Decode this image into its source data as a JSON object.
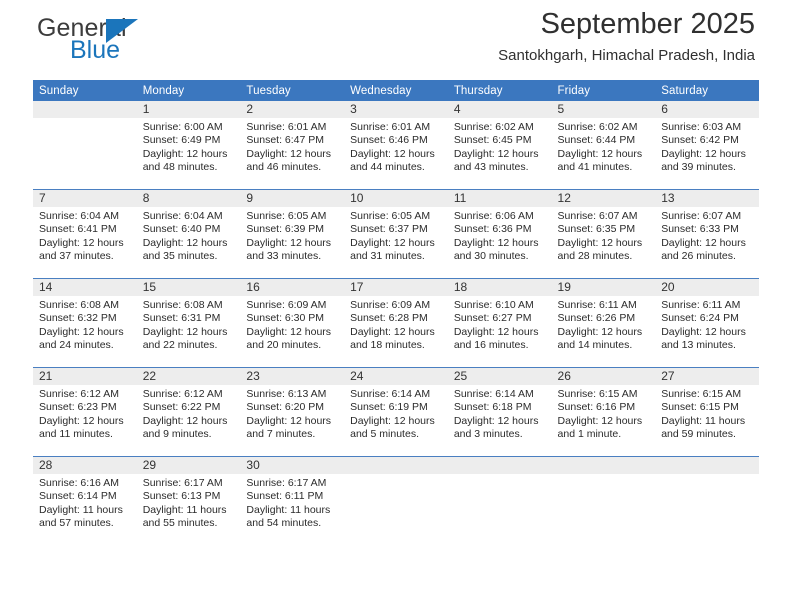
{
  "brand": {
    "line1": "General",
    "line2": "Blue",
    "accent_color": "#1b75bb"
  },
  "header": {
    "title": "September 2025",
    "location": "Santokhgarh, Himachal Pradesh, India",
    "header_bar_color": "#3b77bf",
    "daynum_band_color": "#ededed"
  },
  "weekdays": [
    "Sunday",
    "Monday",
    "Tuesday",
    "Wednesday",
    "Thursday",
    "Friday",
    "Saturday"
  ],
  "weeks": [
    [
      {
        "day": "",
        "sunrise": "",
        "sunset": "",
        "daylight1": "",
        "daylight2": ""
      },
      {
        "day": "1",
        "sunrise": "Sunrise: 6:00 AM",
        "sunset": "Sunset: 6:49 PM",
        "daylight1": "Daylight: 12 hours",
        "daylight2": "and 48 minutes."
      },
      {
        "day": "2",
        "sunrise": "Sunrise: 6:01 AM",
        "sunset": "Sunset: 6:47 PM",
        "daylight1": "Daylight: 12 hours",
        "daylight2": "and 46 minutes."
      },
      {
        "day": "3",
        "sunrise": "Sunrise: 6:01 AM",
        "sunset": "Sunset: 6:46 PM",
        "daylight1": "Daylight: 12 hours",
        "daylight2": "and 44 minutes."
      },
      {
        "day": "4",
        "sunrise": "Sunrise: 6:02 AM",
        "sunset": "Sunset: 6:45 PM",
        "daylight1": "Daylight: 12 hours",
        "daylight2": "and 43 minutes."
      },
      {
        "day": "5",
        "sunrise": "Sunrise: 6:02 AM",
        "sunset": "Sunset: 6:44 PM",
        "daylight1": "Daylight: 12 hours",
        "daylight2": "and 41 minutes."
      },
      {
        "day": "6",
        "sunrise": "Sunrise: 6:03 AM",
        "sunset": "Sunset: 6:42 PM",
        "daylight1": "Daylight: 12 hours",
        "daylight2": "and 39 minutes."
      }
    ],
    [
      {
        "day": "7",
        "sunrise": "Sunrise: 6:04 AM",
        "sunset": "Sunset: 6:41 PM",
        "daylight1": "Daylight: 12 hours",
        "daylight2": "and 37 minutes."
      },
      {
        "day": "8",
        "sunrise": "Sunrise: 6:04 AM",
        "sunset": "Sunset: 6:40 PM",
        "daylight1": "Daylight: 12 hours",
        "daylight2": "and 35 minutes."
      },
      {
        "day": "9",
        "sunrise": "Sunrise: 6:05 AM",
        "sunset": "Sunset: 6:39 PM",
        "daylight1": "Daylight: 12 hours",
        "daylight2": "and 33 minutes."
      },
      {
        "day": "10",
        "sunrise": "Sunrise: 6:05 AM",
        "sunset": "Sunset: 6:37 PM",
        "daylight1": "Daylight: 12 hours",
        "daylight2": "and 31 minutes."
      },
      {
        "day": "11",
        "sunrise": "Sunrise: 6:06 AM",
        "sunset": "Sunset: 6:36 PM",
        "daylight1": "Daylight: 12 hours",
        "daylight2": "and 30 minutes."
      },
      {
        "day": "12",
        "sunrise": "Sunrise: 6:07 AM",
        "sunset": "Sunset: 6:35 PM",
        "daylight1": "Daylight: 12 hours",
        "daylight2": "and 28 minutes."
      },
      {
        "day": "13",
        "sunrise": "Sunrise: 6:07 AM",
        "sunset": "Sunset: 6:33 PM",
        "daylight1": "Daylight: 12 hours",
        "daylight2": "and 26 minutes."
      }
    ],
    [
      {
        "day": "14",
        "sunrise": "Sunrise: 6:08 AM",
        "sunset": "Sunset: 6:32 PM",
        "daylight1": "Daylight: 12 hours",
        "daylight2": "and 24 minutes."
      },
      {
        "day": "15",
        "sunrise": "Sunrise: 6:08 AM",
        "sunset": "Sunset: 6:31 PM",
        "daylight1": "Daylight: 12 hours",
        "daylight2": "and 22 minutes."
      },
      {
        "day": "16",
        "sunrise": "Sunrise: 6:09 AM",
        "sunset": "Sunset: 6:30 PM",
        "daylight1": "Daylight: 12 hours",
        "daylight2": "and 20 minutes."
      },
      {
        "day": "17",
        "sunrise": "Sunrise: 6:09 AM",
        "sunset": "Sunset: 6:28 PM",
        "daylight1": "Daylight: 12 hours",
        "daylight2": "and 18 minutes."
      },
      {
        "day": "18",
        "sunrise": "Sunrise: 6:10 AM",
        "sunset": "Sunset: 6:27 PM",
        "daylight1": "Daylight: 12 hours",
        "daylight2": "and 16 minutes."
      },
      {
        "day": "19",
        "sunrise": "Sunrise: 6:11 AM",
        "sunset": "Sunset: 6:26 PM",
        "daylight1": "Daylight: 12 hours",
        "daylight2": "and 14 minutes."
      },
      {
        "day": "20",
        "sunrise": "Sunrise: 6:11 AM",
        "sunset": "Sunset: 6:24 PM",
        "daylight1": "Daylight: 12 hours",
        "daylight2": "and 13 minutes."
      }
    ],
    [
      {
        "day": "21",
        "sunrise": "Sunrise: 6:12 AM",
        "sunset": "Sunset: 6:23 PM",
        "daylight1": "Daylight: 12 hours",
        "daylight2": "and 11 minutes."
      },
      {
        "day": "22",
        "sunrise": "Sunrise: 6:12 AM",
        "sunset": "Sunset: 6:22 PM",
        "daylight1": "Daylight: 12 hours",
        "daylight2": "and 9 minutes."
      },
      {
        "day": "23",
        "sunrise": "Sunrise: 6:13 AM",
        "sunset": "Sunset: 6:20 PM",
        "daylight1": "Daylight: 12 hours",
        "daylight2": "and 7 minutes."
      },
      {
        "day": "24",
        "sunrise": "Sunrise: 6:14 AM",
        "sunset": "Sunset: 6:19 PM",
        "daylight1": "Daylight: 12 hours",
        "daylight2": "and 5 minutes."
      },
      {
        "day": "25",
        "sunrise": "Sunrise: 6:14 AM",
        "sunset": "Sunset: 6:18 PM",
        "daylight1": "Daylight: 12 hours",
        "daylight2": "and 3 minutes."
      },
      {
        "day": "26",
        "sunrise": "Sunrise: 6:15 AM",
        "sunset": "Sunset: 6:16 PM",
        "daylight1": "Daylight: 12 hours",
        "daylight2": "and 1 minute."
      },
      {
        "day": "27",
        "sunrise": "Sunrise: 6:15 AM",
        "sunset": "Sunset: 6:15 PM",
        "daylight1": "Daylight: 11 hours",
        "daylight2": "and 59 minutes."
      }
    ],
    [
      {
        "day": "28",
        "sunrise": "Sunrise: 6:16 AM",
        "sunset": "Sunset: 6:14 PM",
        "daylight1": "Daylight: 11 hours",
        "daylight2": "and 57 minutes."
      },
      {
        "day": "29",
        "sunrise": "Sunrise: 6:17 AM",
        "sunset": "Sunset: 6:13 PM",
        "daylight1": "Daylight: 11 hours",
        "daylight2": "and 55 minutes."
      },
      {
        "day": "30",
        "sunrise": "Sunrise: 6:17 AM",
        "sunset": "Sunset: 6:11 PM",
        "daylight1": "Daylight: 11 hours",
        "daylight2": "and 54 minutes."
      },
      {
        "day": "",
        "sunrise": "",
        "sunset": "",
        "daylight1": "",
        "daylight2": ""
      },
      {
        "day": "",
        "sunrise": "",
        "sunset": "",
        "daylight1": "",
        "daylight2": ""
      },
      {
        "day": "",
        "sunrise": "",
        "sunset": "",
        "daylight1": "",
        "daylight2": ""
      },
      {
        "day": "",
        "sunrise": "",
        "sunset": "",
        "daylight1": "",
        "daylight2": ""
      }
    ]
  ]
}
